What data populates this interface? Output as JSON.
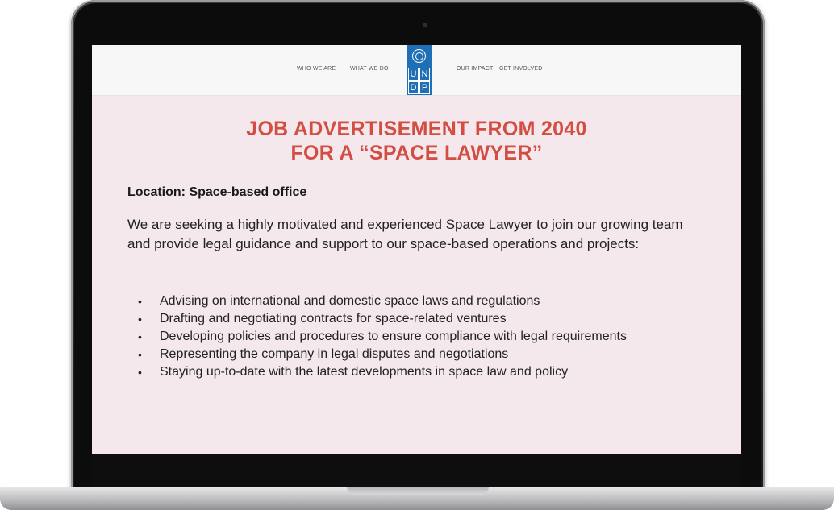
{
  "nav": {
    "who_we_are": "WHO WE ARE",
    "what_we_do": "WHAT WE DO",
    "our_impact": "OUR IMPACT",
    "get_involved": "GET INVOLVED"
  },
  "logo": {
    "letters": [
      "U",
      "N",
      "D",
      "P"
    ],
    "color": "#1f6fb7"
  },
  "article": {
    "title_line1": "JOB ADVERTISEMENT FROM 2040",
    "title_line2": "FOR A “SPACE LAWYER”",
    "location": "Location: Space-based office",
    "intro": "We are seeking a highly motivated and experienced Space Lawyer to join our growing team and provide legal guidance and support to our space-based operations and projects:",
    "bullets": [
      "Advising on international and domestic space laws and regulations",
      "Drafting and negotiating contracts for space-related ventures",
      "Developing policies and procedures to ensure compliance with legal requirements",
      "Representing the company in legal disputes and negotiations",
      "Staying up-to-date with the latest developments in space law and policy"
    ],
    "bullet_glyph": "•"
  },
  "colors": {
    "title_red": "#d24d42",
    "content_bg": "#f5e8ec"
  }
}
